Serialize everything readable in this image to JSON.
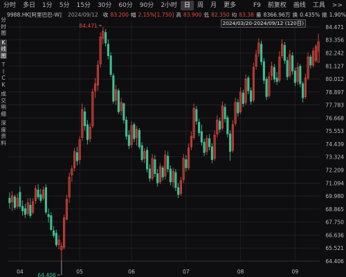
{
  "toolbar": {
    "tabs": [
      {
        "label": "分时",
        "active": false
      },
      {
        "label": "多日",
        "active": false
      },
      {
        "label": "1分",
        "active": false
      },
      {
        "label": "5分",
        "active": false
      },
      {
        "label": "15分",
        "active": false
      },
      {
        "label": "30分",
        "active": false
      },
      {
        "label": "60分",
        "active": false
      },
      {
        "label": "90分",
        "active": false
      },
      {
        "label": "2小时",
        "active": false
      },
      {
        "label": "日",
        "active": true
      },
      {
        "label": "周",
        "active": false
      },
      {
        "label": "月",
        "active": false
      },
      {
        "label": "更多",
        "active": false
      }
    ],
    "right": [
      "F9",
      "前复权",
      "画线",
      "工具",
      ">>"
    ]
  },
  "quote": {
    "code": "9988.HK[阿里巴巴-W]",
    "date": "2024/09/12",
    "close_label": "收",
    "close": "83.200",
    "change_label": "幅",
    "change": "2.15%[1.750]",
    "high_label": "高",
    "high": "83.900",
    "low_label": "低",
    "low": "82.350",
    "avg_label": "均",
    "avg": "83.38",
    "amount_label": "量",
    "amount": "8366.96万",
    "turnover_label": "换",
    "turnover": "0.435%",
    "amp_label": "振",
    "amp": "1.90%"
  },
  "range_label": "2024/03/20-2024/09/12 (120日)",
  "side": {
    "items": [
      {
        "label": "分时图",
        "active": false
      },
      {
        "label": "K线图",
        "active": true
      },
      {
        "label": "TICK",
        "active": false
      },
      {
        "label": "成交明细",
        "active": false
      },
      {
        "label": "深度资料",
        "active": false
      }
    ]
  },
  "colors": {
    "up": "#e2483d",
    "down": "#3fbf91",
    "grid": "#2c2c30",
    "background": "#0e0e10"
  },
  "chart_data": {
    "type": "candlestick",
    "ylim": [
      64.406,
      85.0
    ],
    "y_ticks": [
      "84.471",
      "83.356",
      "82.242",
      "81.127",
      "80.012",
      "78.897",
      "77.783",
      "76.668",
      "75.553",
      "74.439",
      "73.324",
      "72.209",
      "71.094",
      "69.980",
      "68.865",
      "67.750",
      "66.636",
      "65.521",
      "64.406"
    ],
    "x_labels": [
      {
        "label": "04",
        "index": 4
      },
      {
        "label": "05",
        "index": 27
      },
      {
        "label": "06",
        "index": 47
      },
      {
        "label": "07",
        "index": 68
      },
      {
        "label": "08",
        "index": 89
      },
      {
        "label": "09",
        "index": 110
      }
    ],
    "annotations": [
      {
        "label": "84.471",
        "index": 36,
        "value": 84.471,
        "kind": "high"
      },
      {
        "label": "64.406",
        "index": 20,
        "value": 64.406,
        "kind": "low"
      }
    ],
    "candles": [
      {
        "o": 69.8,
        "h": 70.3,
        "l": 68.9,
        "c": 69.4
      },
      {
        "o": 69.5,
        "h": 70.4,
        "l": 68.7,
        "c": 70.0
      },
      {
        "o": 69.9,
        "h": 70.1,
        "l": 68.8,
        "c": 69.0
      },
      {
        "o": 69.1,
        "h": 70.2,
        "l": 68.9,
        "c": 69.8
      },
      {
        "o": 70.3,
        "h": 70.8,
        "l": 68.9,
        "c": 69.1
      },
      {
        "o": 69.1,
        "h": 69.6,
        "l": 68.3,
        "c": 68.7
      },
      {
        "o": 68.9,
        "h": 69.3,
        "l": 68.1,
        "c": 68.4
      },
      {
        "o": 68.5,
        "h": 69.8,
        "l": 68.3,
        "c": 69.4
      },
      {
        "o": 69.2,
        "h": 69.8,
        "l": 68.1,
        "c": 68.3
      },
      {
        "o": 68.6,
        "h": 69.8,
        "l": 68.4,
        "c": 69.5
      },
      {
        "o": 69.6,
        "h": 70.9,
        "l": 69.3,
        "c": 70.6
      },
      {
        "o": 70.5,
        "h": 71.0,
        "l": 69.7,
        "c": 69.9
      },
      {
        "o": 70.1,
        "h": 70.6,
        "l": 69.4,
        "c": 69.6
      },
      {
        "o": 69.8,
        "h": 70.8,
        "l": 69.6,
        "c": 70.5
      },
      {
        "o": 70.7,
        "h": 71.0,
        "l": 68.4,
        "c": 68.6
      },
      {
        "o": 68.4,
        "h": 68.9,
        "l": 67.7,
        "c": 68.2
      },
      {
        "o": 68.3,
        "h": 68.6,
        "l": 67.0,
        "c": 67.1
      },
      {
        "o": 67.0,
        "h": 67.4,
        "l": 66.4,
        "c": 66.6
      },
      {
        "o": 66.8,
        "h": 67.1,
        "l": 65.6,
        "c": 65.8
      },
      {
        "o": 65.8,
        "h": 66.6,
        "l": 65.4,
        "c": 66.2
      },
      {
        "o": 65.4,
        "h": 66.0,
        "l": 64.406,
        "c": 65.7
      },
      {
        "o": 65.6,
        "h": 68.4,
        "l": 65.4,
        "c": 68.1
      },
      {
        "o": 68.0,
        "h": 70.1,
        "l": 67.9,
        "c": 69.7
      },
      {
        "o": 69.9,
        "h": 72.0,
        "l": 69.4,
        "c": 71.6
      },
      {
        "o": 71.8,
        "h": 72.6,
        "l": 71.2,
        "c": 72.3
      },
      {
        "o": 72.4,
        "h": 74.1,
        "l": 72.1,
        "c": 73.8
      },
      {
        "o": 73.7,
        "h": 74.2,
        "l": 72.6,
        "c": 73.0
      },
      {
        "o": 73.1,
        "h": 75.1,
        "l": 72.7,
        "c": 74.8
      },
      {
        "o": 75.0,
        "h": 77.9,
        "l": 74.7,
        "c": 77.4
      },
      {
        "o": 77.2,
        "h": 77.6,
        "l": 75.6,
        "c": 76.0
      },
      {
        "o": 76.1,
        "h": 76.5,
        "l": 74.4,
        "c": 74.8
      },
      {
        "o": 74.9,
        "h": 76.2,
        "l": 74.6,
        "c": 75.9
      },
      {
        "o": 76.0,
        "h": 79.2,
        "l": 75.8,
        "c": 78.9
      },
      {
        "o": 79.0,
        "h": 80.1,
        "l": 78.4,
        "c": 79.6
      },
      {
        "o": 79.5,
        "h": 81.6,
        "l": 79.0,
        "c": 81.2
      },
      {
        "o": 81.3,
        "h": 84.0,
        "l": 81.0,
        "c": 83.6
      },
      {
        "o": 83.5,
        "h": 84.471,
        "l": 83.0,
        "c": 84.1
      },
      {
        "o": 84.0,
        "h": 84.3,
        "l": 82.8,
        "c": 83.1
      },
      {
        "o": 83.0,
        "h": 83.4,
        "l": 81.7,
        "c": 82.0
      },
      {
        "o": 82.0,
        "h": 82.3,
        "l": 80.2,
        "c": 80.4
      },
      {
        "o": 80.3,
        "h": 80.5,
        "l": 77.9,
        "c": 78.1
      },
      {
        "o": 78.2,
        "h": 79.5,
        "l": 77.8,
        "c": 79.1
      },
      {
        "o": 79.0,
        "h": 79.2,
        "l": 77.0,
        "c": 77.2
      },
      {
        "o": 77.3,
        "h": 78.4,
        "l": 76.9,
        "c": 78.0
      },
      {
        "o": 77.9,
        "h": 78.0,
        "l": 76.2,
        "c": 76.5
      },
      {
        "o": 76.5,
        "h": 76.8,
        "l": 74.8,
        "c": 75.1
      },
      {
        "o": 75.2,
        "h": 75.6,
        "l": 74.0,
        "c": 74.3
      },
      {
        "o": 74.4,
        "h": 76.4,
        "l": 74.1,
        "c": 76.0
      },
      {
        "o": 76.1,
        "h": 76.3,
        "l": 74.6,
        "c": 74.9
      },
      {
        "o": 75.0,
        "h": 76.0,
        "l": 74.3,
        "c": 75.7
      },
      {
        "o": 75.6,
        "h": 75.8,
        "l": 74.0,
        "c": 74.2
      },
      {
        "o": 74.3,
        "h": 74.6,
        "l": 72.9,
        "c": 73.1
      },
      {
        "o": 73.2,
        "h": 74.1,
        "l": 72.8,
        "c": 73.8
      },
      {
        "o": 73.9,
        "h": 74.2,
        "l": 72.0,
        "c": 72.3
      },
      {
        "o": 72.3,
        "h": 72.7,
        "l": 71.2,
        "c": 71.5
      },
      {
        "o": 71.5,
        "h": 73.6,
        "l": 71.3,
        "c": 73.2
      },
      {
        "o": 73.1,
        "h": 73.5,
        "l": 71.6,
        "c": 71.9
      },
      {
        "o": 71.9,
        "h": 72.3,
        "l": 70.8,
        "c": 71.1
      },
      {
        "o": 71.2,
        "h": 72.8,
        "l": 71.0,
        "c": 72.5
      },
      {
        "o": 72.4,
        "h": 72.6,
        "l": 71.3,
        "c": 71.6
      },
      {
        "o": 71.7,
        "h": 73.9,
        "l": 71.4,
        "c": 73.5
      },
      {
        "o": 73.4,
        "h": 73.8,
        "l": 72.0,
        "c": 72.3
      },
      {
        "o": 72.3,
        "h": 72.6,
        "l": 70.9,
        "c": 71.2
      },
      {
        "o": 71.2,
        "h": 72.4,
        "l": 70.7,
        "c": 72.1
      },
      {
        "o": 72.0,
        "h": 72.3,
        "l": 70.4,
        "c": 70.7
      },
      {
        "o": 70.7,
        "h": 71.1,
        "l": 69.8,
        "c": 70.1
      },
      {
        "o": 70.2,
        "h": 71.6,
        "l": 70.0,
        "c": 71.3
      },
      {
        "o": 71.4,
        "h": 73.6,
        "l": 71.1,
        "c": 73.2
      },
      {
        "o": 73.1,
        "h": 73.5,
        "l": 72.1,
        "c": 72.4
      },
      {
        "o": 72.4,
        "h": 74.5,
        "l": 72.2,
        "c": 74.1
      },
      {
        "o": 74.2,
        "h": 75.5,
        "l": 73.9,
        "c": 75.1
      },
      {
        "o": 75.0,
        "h": 77.9,
        "l": 74.8,
        "c": 77.5
      },
      {
        "o": 77.4,
        "h": 77.7,
        "l": 76.1,
        "c": 76.4
      },
      {
        "o": 76.3,
        "h": 76.6,
        "l": 75.1,
        "c": 75.4
      },
      {
        "o": 75.5,
        "h": 76.1,
        "l": 74.3,
        "c": 74.6
      },
      {
        "o": 74.6,
        "h": 74.9,
        "l": 73.4,
        "c": 73.7
      },
      {
        "o": 73.8,
        "h": 75.2,
        "l": 73.5,
        "c": 74.9
      },
      {
        "o": 74.9,
        "h": 75.3,
        "l": 73.9,
        "c": 74.2
      },
      {
        "o": 74.2,
        "h": 74.5,
        "l": 72.8,
        "c": 73.1
      },
      {
        "o": 73.2,
        "h": 75.6,
        "l": 73.0,
        "c": 75.2
      },
      {
        "o": 75.3,
        "h": 76.9,
        "l": 75.0,
        "c": 76.5
      },
      {
        "o": 76.4,
        "h": 76.7,
        "l": 75.4,
        "c": 75.7
      },
      {
        "o": 75.8,
        "h": 78.1,
        "l": 75.6,
        "c": 77.7
      },
      {
        "o": 77.6,
        "h": 77.9,
        "l": 76.3,
        "c": 76.6
      },
      {
        "o": 76.7,
        "h": 76.9,
        "l": 75.0,
        "c": 75.3
      },
      {
        "o": 75.3,
        "h": 75.6,
        "l": 73.0,
        "c": 73.8
      },
      {
        "o": 73.9,
        "h": 76.5,
        "l": 73.7,
        "c": 76.1
      },
      {
        "o": 76.2,
        "h": 78.4,
        "l": 76.0,
        "c": 78.0
      },
      {
        "o": 78.0,
        "h": 78.3,
        "l": 76.8,
        "c": 77.1
      },
      {
        "o": 77.2,
        "h": 79.3,
        "l": 77.0,
        "c": 78.9
      },
      {
        "o": 78.8,
        "h": 79.1,
        "l": 77.6,
        "c": 77.9
      },
      {
        "o": 78.0,
        "h": 80.4,
        "l": 77.8,
        "c": 80.0
      },
      {
        "o": 80.1,
        "h": 80.3,
        "l": 78.7,
        "c": 79.0
      },
      {
        "o": 79.0,
        "h": 79.3,
        "l": 77.8,
        "c": 78.1
      },
      {
        "o": 78.2,
        "h": 81.4,
        "l": 78.0,
        "c": 81.0
      },
      {
        "o": 81.1,
        "h": 82.5,
        "l": 80.8,
        "c": 82.1
      },
      {
        "o": 82.2,
        "h": 83.5,
        "l": 81.9,
        "c": 83.1
      },
      {
        "o": 83.0,
        "h": 83.3,
        "l": 81.2,
        "c": 81.5
      },
      {
        "o": 81.5,
        "h": 81.8,
        "l": 79.6,
        "c": 79.9
      },
      {
        "o": 80.0,
        "h": 80.2,
        "l": 78.2,
        "c": 78.5
      },
      {
        "o": 78.6,
        "h": 80.6,
        "l": 78.4,
        "c": 80.2
      },
      {
        "o": 80.3,
        "h": 81.5,
        "l": 79.9,
        "c": 81.1
      },
      {
        "o": 81.0,
        "h": 81.3,
        "l": 79.7,
        "c": 80.0
      },
      {
        "o": 80.1,
        "h": 80.6,
        "l": 79.5,
        "c": 79.8
      },
      {
        "o": 79.9,
        "h": 82.4,
        "l": 79.7,
        "c": 81.9
      },
      {
        "o": 82.0,
        "h": 83.4,
        "l": 81.8,
        "c": 83.0
      },
      {
        "o": 82.9,
        "h": 83.2,
        "l": 81.3,
        "c": 81.6
      },
      {
        "o": 81.6,
        "h": 81.9,
        "l": 79.9,
        "c": 80.2
      },
      {
        "o": 80.3,
        "h": 82.5,
        "l": 80.1,
        "c": 82.1
      },
      {
        "o": 82.0,
        "h": 82.3,
        "l": 80.4,
        "c": 80.7
      },
      {
        "o": 80.7,
        "h": 81.0,
        "l": 79.4,
        "c": 79.7
      },
      {
        "o": 79.8,
        "h": 81.4,
        "l": 79.5,
        "c": 81.0
      },
      {
        "o": 81.1,
        "h": 81.3,
        "l": 79.3,
        "c": 79.6
      },
      {
        "o": 79.6,
        "h": 79.8,
        "l": 78.0,
        "c": 78.4
      },
      {
        "o": 78.5,
        "h": 80.5,
        "l": 78.3,
        "c": 80.1
      },
      {
        "o": 80.1,
        "h": 82.3,
        "l": 79.9,
        "c": 81.9
      },
      {
        "o": 81.9,
        "h": 82.1,
        "l": 80.9,
        "c": 81.2
      },
      {
        "o": 81.2,
        "h": 82.7,
        "l": 81.0,
        "c": 82.4
      },
      {
        "o": 81.6,
        "h": 83.0,
        "l": 81.4,
        "c": 82.8
      },
      {
        "o": 81.45,
        "h": 83.9,
        "l": 82.35,
        "c": 83.2
      }
    ]
  }
}
